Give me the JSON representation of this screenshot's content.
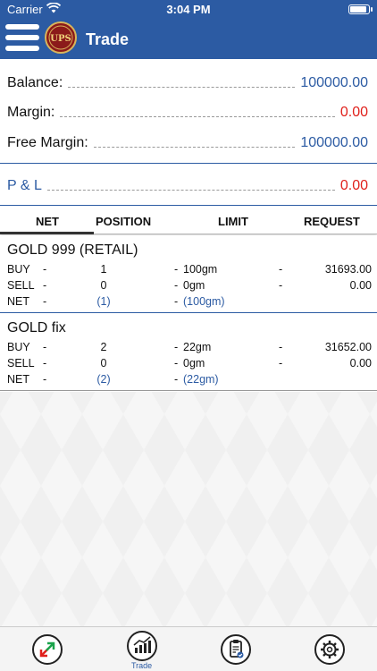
{
  "status_bar": {
    "carrier": "Carrier",
    "time": "3:04 PM"
  },
  "header": {
    "title": "Trade",
    "logo_text": "UPS"
  },
  "account": {
    "balance_label": "Balance:",
    "balance_value": "100000.00",
    "margin_label": "Margin:",
    "margin_value": "0.00",
    "free_margin_label": "Free Margin:",
    "free_margin_value": "100000.00",
    "pl_label": "P & L",
    "pl_value": "0.00"
  },
  "tabs": [
    "NET",
    "POSITION",
    "LIMIT",
    "REQUEST"
  ],
  "products": [
    {
      "name": "GOLD 999 (RETAIL)",
      "rows": [
        {
          "label": "BUY",
          "d1": "-",
          "position": "1",
          "d2": "-",
          "limit": "100gm",
          "d3": "-",
          "request": "31693.00"
        },
        {
          "label": "SELL",
          "d1": "-",
          "position": "0",
          "d2": "-",
          "limit": "0gm",
          "d3": "-",
          "request": "0.00"
        },
        {
          "label": "NET",
          "d1": "-",
          "position": "(1)",
          "d2": "-",
          "limit": "(100gm)",
          "d3": "",
          "request": ""
        }
      ]
    },
    {
      "name": "GOLD fix",
      "rows": [
        {
          "label": "BUY",
          "d1": "-",
          "position": "2",
          "d2": "-",
          "limit": "22gm",
          "d3": "-",
          "request": "31652.00"
        },
        {
          "label": "SELL",
          "d1": "-",
          "position": "0",
          "d2": "-",
          "limit": "0gm",
          "d3": "-",
          "request": "0.00"
        },
        {
          "label": "NET",
          "d1": "-",
          "position": "(2)",
          "d2": "-",
          "limit": "(22gm)",
          "d3": "",
          "request": ""
        }
      ]
    }
  ],
  "bottom_nav": {
    "items": [
      {
        "icon": "arrows-in-out-icon",
        "label": ""
      },
      {
        "icon": "chart-icon",
        "label": "Trade"
      },
      {
        "icon": "clipboard-check-icon",
        "label": ""
      },
      {
        "icon": "gear-icon",
        "label": ""
      }
    ]
  },
  "colors": {
    "brand": "#2c5ba3",
    "negative": "#e0201b"
  }
}
